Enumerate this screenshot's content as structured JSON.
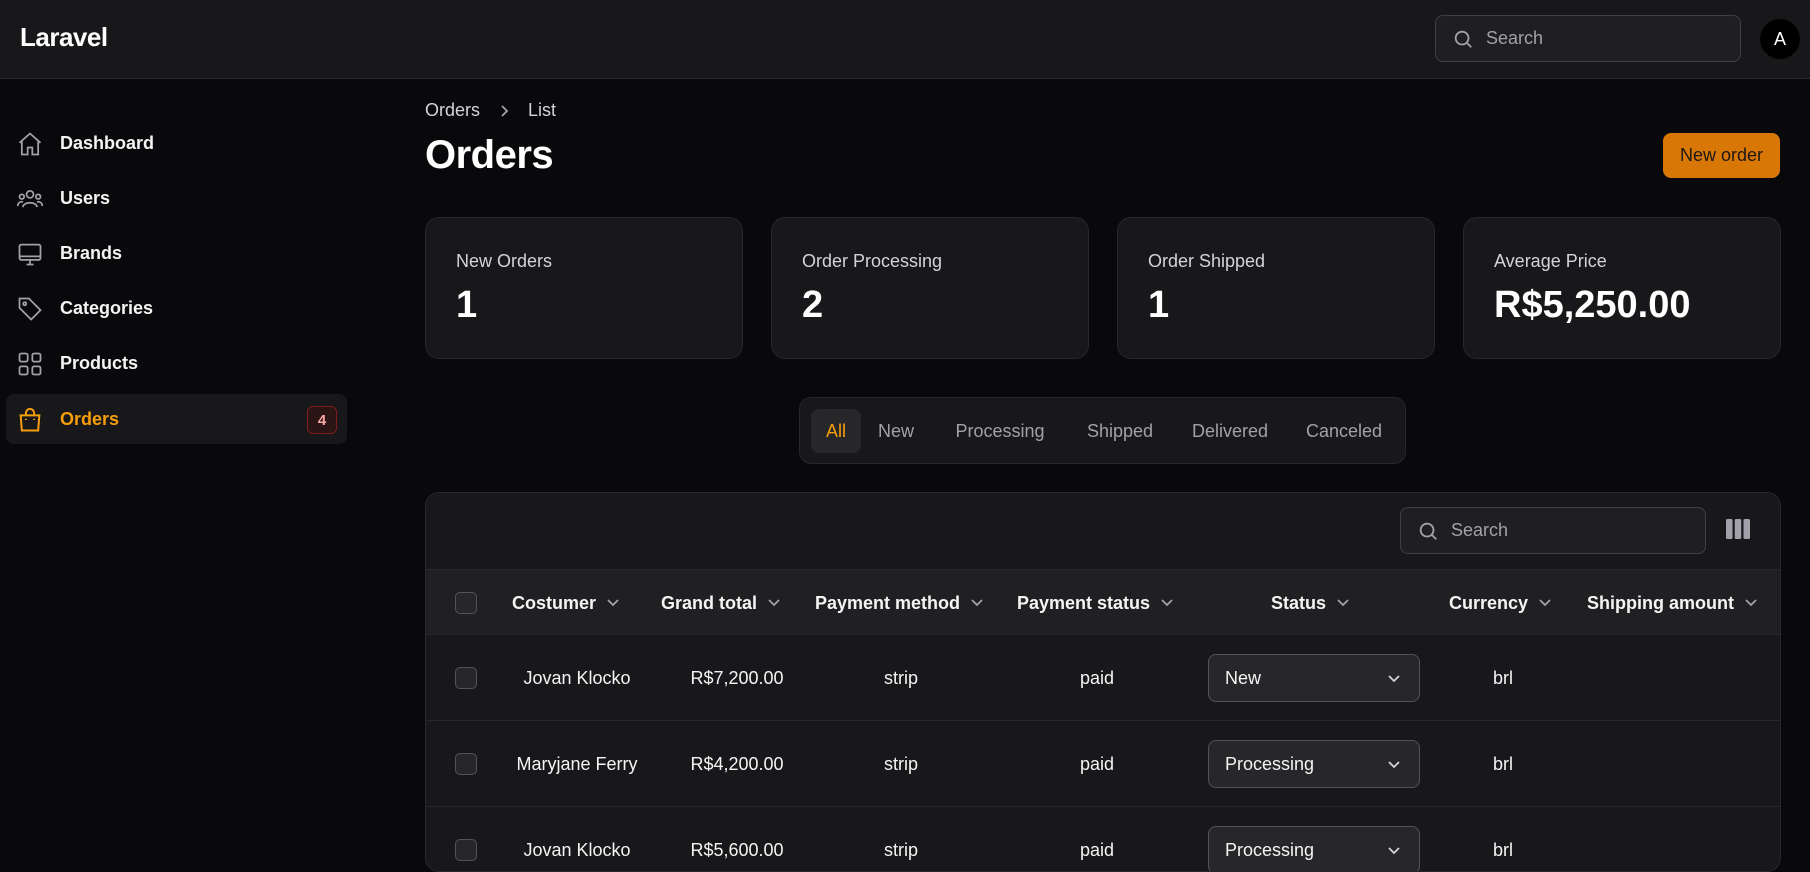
{
  "app": {
    "logo": "Laravel"
  },
  "topbar": {
    "search_placeholder": "Search",
    "avatar_initial": "A"
  },
  "sidebar": {
    "items": [
      {
        "label": "Dashboard",
        "icon": "home-icon"
      },
      {
        "label": "Users",
        "icon": "users-icon"
      },
      {
        "label": "Brands",
        "icon": "monitor-icon"
      },
      {
        "label": "Categories",
        "icon": "tag-icon"
      },
      {
        "label": "Products",
        "icon": "grid-icon"
      },
      {
        "label": "Orders",
        "icon": "shopping-bag-icon",
        "badge": "4",
        "active": true
      }
    ]
  },
  "breadcrumb": {
    "parent": "Orders",
    "current": "List"
  },
  "page": {
    "title": "Orders",
    "new_button": "New order"
  },
  "stats": [
    {
      "label": "New Orders",
      "value": "1"
    },
    {
      "label": "Order Processing",
      "value": "2"
    },
    {
      "label": "Order Shipped",
      "value": "1"
    },
    {
      "label": "Average Price",
      "value": "R$5,250.00"
    }
  ],
  "tabs": [
    "All",
    "New",
    "Processing",
    "Shipped",
    "Delivered",
    "Canceled"
  ],
  "active_tab": "All",
  "table": {
    "search_placeholder": "Search",
    "columns": [
      "Costumer",
      "Grand total",
      "Payment method",
      "Payment status",
      "Status",
      "Currency",
      "Shipping amount"
    ],
    "rows": [
      {
        "customer": "Jovan Klocko",
        "grand_total": "R$7,200.00",
        "payment_method": "strip",
        "payment_status": "paid",
        "status": "New",
        "currency": "brl",
        "shipping_amount": ""
      },
      {
        "customer": "Maryjane Ferry",
        "grand_total": "R$4,200.00",
        "payment_method": "strip",
        "payment_status": "paid",
        "status": "Processing",
        "currency": "brl",
        "shipping_amount": ""
      },
      {
        "customer": "Jovan Klocko",
        "grand_total": "R$5,600.00",
        "payment_method": "strip",
        "payment_status": "paid",
        "status": "Processing",
        "currency": "brl",
        "shipping_amount": ""
      }
    ]
  },
  "colors": {
    "accent": "#f59e0b",
    "primary_button": "#d97706",
    "background": "#09090b",
    "surface": "#18181b"
  }
}
